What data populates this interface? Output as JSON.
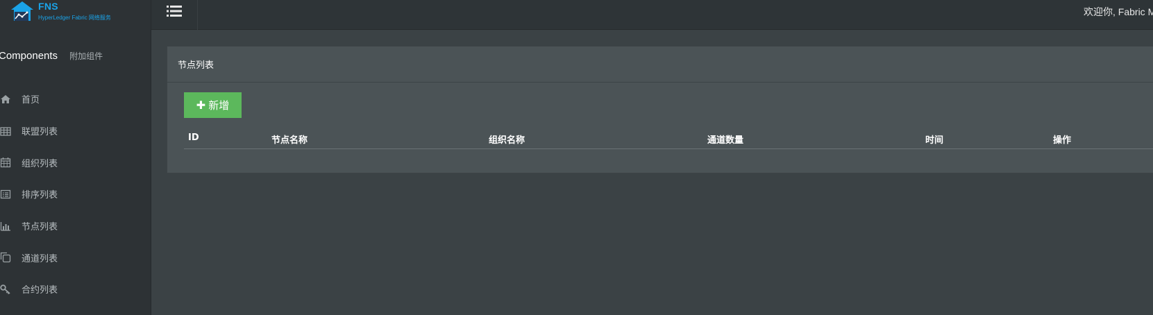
{
  "logo": {
    "name": "FNS",
    "subtitle": "HyperLedger Fabric 网络服务"
  },
  "sidebar": {
    "header_title": "Components",
    "header_sub": "附加组件",
    "items": [
      {
        "label": "首页",
        "icon": "home-icon"
      },
      {
        "label": "联盟列表",
        "icon": "table-icon"
      },
      {
        "label": "组织列表",
        "icon": "calendar-icon"
      },
      {
        "label": "排序列表",
        "icon": "list-alt-icon"
      },
      {
        "label": "节点列表",
        "icon": "bar-chart-icon"
      },
      {
        "label": "通道列表",
        "icon": "copy-icon"
      },
      {
        "label": "合约列表",
        "icon": "key-icon"
      }
    ]
  },
  "topbar": {
    "toggle_icon": "list-icon",
    "welcome": "欢迎你, Fabric M"
  },
  "panel": {
    "title": "节点列表",
    "add_button_label": "新增",
    "columns": [
      "ID",
      "节点名称",
      "组织名称",
      "通道数量",
      "时间",
      "操作"
    ],
    "rows": []
  },
  "colors": {
    "brand": "#1aa3e8",
    "add_button": "#5cb85c",
    "sidebar_bg": "#2d3235",
    "content_bg": "#3b4245",
    "panel_bg": "#4b5356"
  }
}
